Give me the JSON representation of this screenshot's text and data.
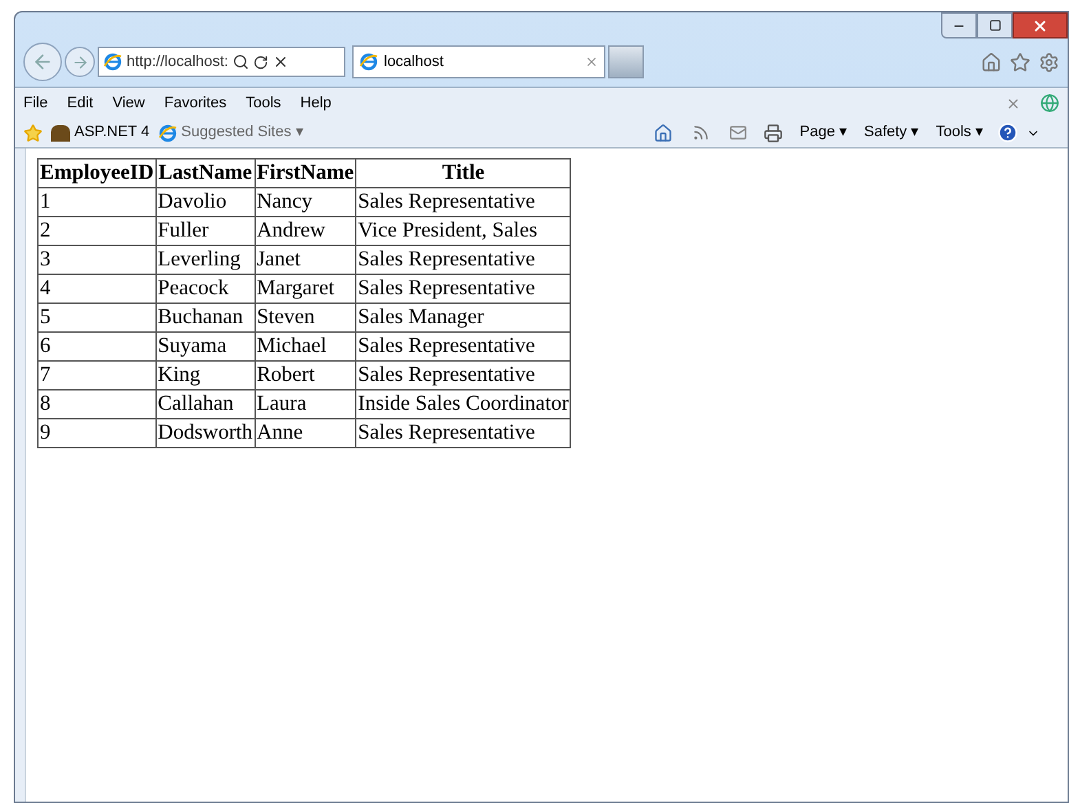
{
  "address_bar": {
    "url": "http://localhost:"
  },
  "tab": {
    "title": "localhost",
    "selected": true
  },
  "menu_bar": [
    "File",
    "Edit",
    "View",
    "Favorites",
    "Tools",
    "Help"
  ],
  "favorites_bar": {
    "links": [
      {
        "label": "ASP.NET 4",
        "kind": "site"
      },
      {
        "label": "Suggested Sites ▾",
        "kind": "ie"
      }
    ]
  },
  "command_bar": {
    "buttons": [
      "Page ▾",
      "Safety ▾",
      "Tools ▾"
    ]
  },
  "table": {
    "columns": [
      "EmployeeID",
      "LastName",
      "FirstName",
      "Title"
    ],
    "rows": [
      [
        "1",
        "Davolio",
        "Nancy",
        "Sales Representative"
      ],
      [
        "2",
        "Fuller",
        "Andrew",
        "Vice President, Sales"
      ],
      [
        "3",
        "Leverling",
        "Janet",
        "Sales Representative"
      ],
      [
        "4",
        "Peacock",
        "Margaret",
        "Sales Representative"
      ],
      [
        "5",
        "Buchanan",
        "Steven",
        "Sales Manager"
      ],
      [
        "6",
        "Suyama",
        "Michael",
        "Sales Representative"
      ],
      [
        "7",
        "King",
        "Robert",
        "Sales Representative"
      ],
      [
        "8",
        "Callahan",
        "Laura",
        "Inside Sales Coordinator"
      ],
      [
        "9",
        "Dodsworth",
        "Anne",
        "Sales Representative"
      ]
    ]
  }
}
